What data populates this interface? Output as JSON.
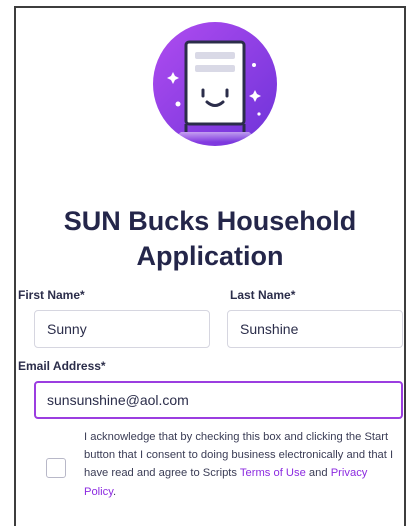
{
  "form": {
    "title": "SUN Bucks Household Application",
    "first_name_label": "First Name*",
    "first_name_value": "Sunny",
    "last_name_label": "Last Name*",
    "last_name_value": "Sunshine",
    "email_label": "Email Address*",
    "email_value": "sunsunshine@aol.com"
  },
  "consent": {
    "text_before": "I acknowledge that by checking this box and clicking the Start button that I consent to doing business electronically and that I have read and agree to Scripts ",
    "terms_link": "Terms of Use",
    "conjunction": " and ",
    "privacy_link": "Privacy Policy",
    "period": ".",
    "checked": false
  },
  "hero": {
    "icon": "smiling-document-icon",
    "colors": {
      "circle_gradient_start": "#b04cf0",
      "circle_gradient_end": "#6e33d9",
      "accent": "#9b3de0"
    }
  }
}
